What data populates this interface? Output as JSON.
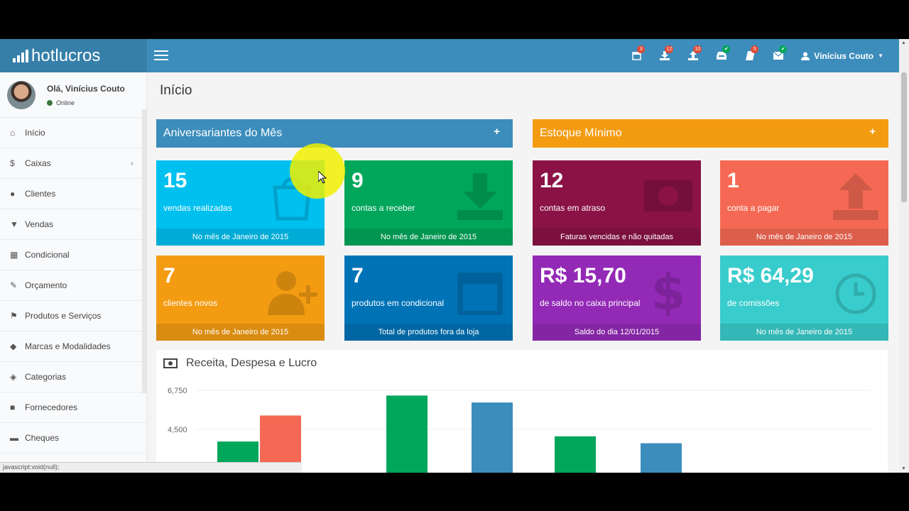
{
  "brand": {
    "name": "hotlucros"
  },
  "header": {
    "icons": [
      {
        "name": "calendar-icon",
        "badge": "3",
        "color": "red"
      },
      {
        "name": "download-icon",
        "badge": "12",
        "color": "red"
      },
      {
        "name": "upload-icon",
        "badge": "10",
        "color": "red"
      },
      {
        "name": "inbox-icon",
        "badge": "✔",
        "color": "green"
      },
      {
        "name": "book-icon",
        "badge": "5",
        "color": "red"
      },
      {
        "name": "envelope-icon",
        "badge": "✔",
        "color": "green"
      }
    ],
    "user_name": "Vinícius Couto"
  },
  "sidebar": {
    "greeting": "Olá, Vinícius Couto",
    "status": "Online",
    "items": [
      {
        "label": "Início",
        "icon": "home-icon"
      },
      {
        "label": "Caixas",
        "icon": "dollar-icon"
      },
      {
        "label": "Clientes",
        "icon": "users-icon"
      },
      {
        "label": "Vendas",
        "icon": "cart-icon"
      },
      {
        "label": "Condicional",
        "icon": "calendar-icon"
      },
      {
        "label": "Orçamento",
        "icon": "pencil-icon"
      },
      {
        "label": "Produtos e Serviços",
        "icon": "flag-icon"
      },
      {
        "label": "Marcas e Modalidades",
        "icon": "tag-icon"
      },
      {
        "label": "Categorias",
        "icon": "tags-icon"
      },
      {
        "label": "Fornecedores",
        "icon": "truck-icon"
      },
      {
        "label": "Cheques",
        "icon": "money-icon"
      }
    ],
    "status_bar": "javascript:void(null);"
  },
  "main": {
    "title": "Início",
    "box_left": {
      "title": "Aniversariantes do Mês",
      "color": "#3c8dbc"
    },
    "box_right": {
      "title": "Estoque Mínimo",
      "color": "#f39c12"
    },
    "tiles": [
      {
        "value": "15",
        "label": "vendas realizadas",
        "footer": "No mês de Janeiro de 2015",
        "color": "#00c0ef",
        "icon": "shopping-bag-icon"
      },
      {
        "value": "9",
        "label": "contas a receber",
        "footer": "No mês de Janeiro de 2015",
        "color": "#00a65a",
        "icon": "download-icon"
      },
      {
        "value": "12",
        "label": "contas em atraso",
        "footer": "Faturas vencidas e não quitadas",
        "color": "#8a1246",
        "icon": "money-icon"
      },
      {
        "value": "1",
        "label": "conta a pagar",
        "footer": "No mês de Janeiro de 2015",
        "color": "#f56954",
        "icon": "upload-icon"
      },
      {
        "value": "7",
        "label": "clientes novos",
        "footer": "No mês de Janeiro de 2015",
        "color": "#f39c12",
        "icon": "user-add-icon"
      },
      {
        "value": "7",
        "label": "produtos em condicional",
        "footer": "Total de produtos fora da loja",
        "color": "#0073b7",
        "icon": "calendar-icon"
      },
      {
        "value": "R$ 15,70",
        "label": "de saldo no caixa principal",
        "footer": "Saldo do dia 12/01/2015",
        "color": "#932ab6",
        "icon": "dollar-icon"
      },
      {
        "value": "R$ 64,29",
        "label": "de comissões",
        "footer": "No mês de Janeiro de 2015",
        "color": "#39cccc",
        "icon": "alarm-clock-icon"
      }
    ]
  },
  "chart_data": {
    "type": "bar",
    "title": "Receita, Despesa e Lucro",
    "y_ticks": [
      "6,750",
      "4,500"
    ],
    "ylim": [
      0,
      6750
    ],
    "grid": true,
    "bars": [
      {
        "group": 0,
        "value": 3800,
        "color": "#00a65a"
      },
      {
        "group": 0,
        "value": 5300,
        "color": "#f56954"
      },
      {
        "group": 1,
        "value": 6450,
        "color": "#00a65a"
      },
      {
        "group": 1,
        "value": 6050,
        "color": "#3c8dbc"
      },
      {
        "group": 2,
        "value": 4100,
        "color": "#00a65a"
      },
      {
        "group": 2,
        "value": 3700,
        "color": "#3c8dbc"
      }
    ]
  }
}
